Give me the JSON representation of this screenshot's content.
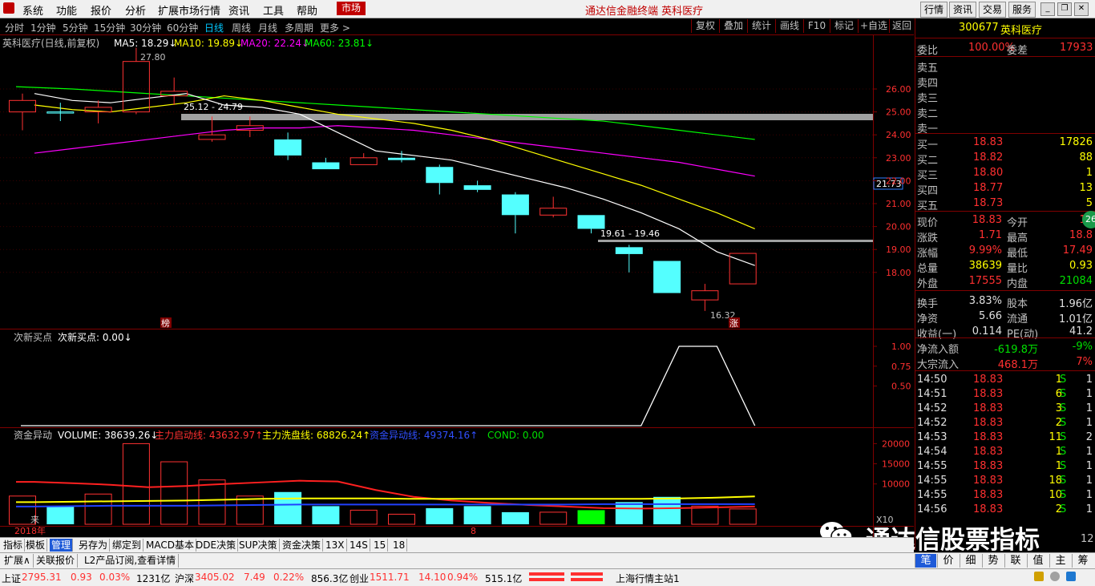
{
  "menu": {
    "items": [
      "系统",
      "功能",
      "报价",
      "分析",
      "扩展市场行情",
      "资讯",
      "工具",
      "帮助"
    ],
    "market_tag": "市场",
    "window_title": "通达信金融终端  英科医疗",
    "right_buttons": [
      "行情",
      "资讯",
      "交易",
      "服务"
    ]
  },
  "periods": {
    "items": [
      "分时",
      "1分钟",
      "5分钟",
      "15分钟",
      "30分钟",
      "60分钟",
      "日线",
      "周线",
      "月线",
      "多周期",
      "更多 >"
    ],
    "active": "日线",
    "right_tools": [
      "复权",
      "叠加",
      "统计",
      "画线",
      "F10",
      "标记",
      "+自选",
      "返回"
    ]
  },
  "main_chart": {
    "stock_label": "英科医疗(日线,前复权)",
    "ma5": "MA5: 18.29↓",
    "ma10": "MA10: 19.89↓",
    "ma20": "MA20: 22.24↓",
    "ma60": "MA60: 23.81↓",
    "price_high_label": "27.80",
    "price_low_label": "16.32",
    "zone1_label": "25.12 - 24.79",
    "zone2_label": "19.61 - 19.46",
    "current_price_tag": "21.73",
    "bang_tag": "榜",
    "zhang_tag": "涨",
    "colors": {
      "ma5": "#ffffff",
      "ma10": "#ffff00",
      "ma20": "#ff00ff",
      "ma60": "#00ff00",
      "up": "#ff3232",
      "down": "#54ffff"
    }
  },
  "chart_data": [
    {
      "type": "candlestick",
      "title": "英科医疗(日线,前复权)",
      "ylim": [
        16.0,
        27.5
      ],
      "yticks": [
        "26.00",
        "25.00",
        "24.00",
        "23.00",
        "22.00",
        "21.00",
        "20.00",
        "19.00",
        "18.00"
      ],
      "candles": [
        {
          "o": 25.0,
          "c": 25.5,
          "h": 25.8,
          "l": 24.2,
          "dir": "up"
        },
        {
          "o": 25.0,
          "c": 25.0,
          "h": 25.4,
          "l": 24.6,
          "dir": "flat"
        },
        {
          "o": 25.0,
          "c": 25.2,
          "h": 25.5,
          "l": 24.5,
          "dir": "up"
        },
        {
          "o": 25.0,
          "c": 27.2,
          "h": 27.8,
          "l": 24.9,
          "dir": "up"
        },
        {
          "o": 25.7,
          "c": 25.9,
          "h": 26.5,
          "l": 25.3,
          "dir": "up"
        },
        {
          "o": 23.8,
          "c": 24.0,
          "h": 24.8,
          "l": 23.7,
          "dir": "up"
        },
        {
          "o": 24.2,
          "c": 24.4,
          "h": 24.8,
          "l": 23.9,
          "dir": "up"
        },
        {
          "o": 23.8,
          "c": 23.1,
          "h": 24.1,
          "l": 22.9,
          "dir": "down"
        },
        {
          "o": 22.8,
          "c": 22.5,
          "h": 23.0,
          "l": 22.5,
          "dir": "down"
        },
        {
          "o": 22.7,
          "c": 23.0,
          "h": 23.2,
          "l": 22.7,
          "dir": "up"
        },
        {
          "o": 23.0,
          "c": 22.9,
          "h": 23.3,
          "l": 22.8,
          "dir": "down"
        },
        {
          "o": 22.6,
          "c": 21.9,
          "h": 22.7,
          "l": 21.4,
          "dir": "down"
        },
        {
          "o": 21.8,
          "c": 21.6,
          "h": 22.0,
          "l": 21.5,
          "dir": "down"
        },
        {
          "o": 21.4,
          "c": 20.5,
          "h": 21.5,
          "l": 19.7,
          "dir": "down"
        },
        {
          "o": 20.5,
          "c": 20.8,
          "h": 21.3,
          "l": 20.4,
          "dir": "up"
        },
        {
          "o": 20.5,
          "c": 19.9,
          "h": 20.5,
          "l": 19.7,
          "dir": "down"
        },
        {
          "o": 19.1,
          "c": 18.8,
          "h": 19.2,
          "l": 18.0,
          "dir": "down"
        },
        {
          "o": 18.5,
          "c": 17.1,
          "h": 18.5,
          "l": 17.1,
          "dir": "down"
        },
        {
          "o": 16.8,
          "c": 17.2,
          "h": 17.5,
          "l": 16.32,
          "dir": "up"
        },
        {
          "o": 17.5,
          "c": 18.83,
          "h": 18.83,
          "l": 17.5,
          "dir": "up"
        }
      ],
      "series": [
        {
          "name": "MA5",
          "values": [
            25.8,
            25.5,
            25.4,
            25.6,
            25.8,
            25.3,
            25.2,
            24.9,
            24.1,
            23.3,
            23.1,
            22.9,
            22.5,
            22.1,
            21.7,
            21.2,
            20.6,
            19.9,
            18.9,
            18.3
          ]
        },
        {
          "name": "MA10",
          "values": [
            25.3,
            25.1,
            25.0,
            25.2,
            25.4,
            25.7,
            25.5,
            25.2,
            24.9,
            24.7,
            24.5,
            24.2,
            23.8,
            23.3,
            22.8,
            22.3,
            21.8,
            21.2,
            20.6,
            19.9
          ]
        },
        {
          "name": "MA20",
          "values": [
            23.2,
            23.4,
            23.6,
            23.8,
            24.0,
            24.2,
            24.3,
            24.3,
            24.4,
            24.3,
            24.2,
            24.0,
            23.8,
            23.6,
            23.4,
            23.2,
            23.0,
            22.8,
            22.5,
            22.2
          ]
        },
        {
          "name": "MA60",
          "values": [
            26.1,
            26.0,
            25.9,
            25.8,
            25.7,
            25.6,
            25.5,
            25.4,
            25.3,
            25.2,
            25.1,
            25.0,
            24.9,
            24.8,
            24.7,
            24.6,
            24.4,
            24.2,
            24.0,
            23.8
          ]
        }
      ]
    },
    {
      "type": "line",
      "title": "次新买点",
      "ylim": [
        0,
        1.0
      ],
      "yticks": [
        "1.00",
        "0.75",
        "0.50"
      ],
      "series": [
        {
          "name": "次新买点",
          "values": [
            0,
            0,
            0,
            0,
            0,
            0,
            0,
            0,
            0,
            0,
            0,
            0,
            0,
            0,
            0,
            0,
            0,
            1,
            1,
            0
          ]
        }
      ]
    },
    {
      "type": "bar",
      "title": "资金异动",
      "ylim": [
        0,
        23000
      ],
      "yticks": [
        "20000",
        "15000",
        "10000"
      ],
      "values": [
        7000,
        4500,
        7500,
        20000,
        15500,
        11000,
        7000,
        8000,
        4500,
        3500,
        2500,
        4000,
        4500,
        3000,
        3000,
        3500,
        5500,
        6800,
        4500,
        3800
      ],
      "bar_dirs": [
        "up",
        "down",
        "up",
        "up",
        "up",
        "up",
        "up",
        "down",
        "down",
        "up",
        "up",
        "down",
        "down",
        "down",
        "up",
        "down",
        "down",
        "down",
        "up",
        "up"
      ],
      "highlight_index": 15,
      "series": [
        {
          "name": "主力启动线",
          "values": [
            10500,
            10200,
            9800,
            9200,
            9500,
            10000,
            10400,
            10800,
            10600,
            8500,
            6800,
            5900,
            5300,
            4800,
            4400,
            4000,
            3900,
            4000,
            4200,
            4400
          ]
        },
        {
          "name": "主力洗盘线",
          "values": [
            5500,
            5600,
            5700,
            5800,
            5900,
            6100,
            6300,
            6400,
            6400,
            6400,
            6300,
            6300,
            6300,
            6300,
            6300,
            6300,
            6300,
            6400,
            6600,
            6900
          ]
        },
        {
          "name": "资金异动线",
          "values": [
            4400,
            4500,
            4600,
            4600,
            4600,
            4700,
            4800,
            4900,
            4900,
            4900,
            4900,
            4900,
            4900,
            4900,
            4900,
            5000,
            5000,
            5000,
            5000,
            5000
          ]
        }
      ]
    }
  ],
  "sub1": {
    "label": "次新买点",
    "value": "次新买点: 0.00↓"
  },
  "sub2": {
    "label": "资金异动",
    "volume": "VOLUME: 38639.26↓",
    "l1": "主力启动线: 43632.97↑",
    "l2": "主力洗盘线: 68826.24↑",
    "l3": "资金异动线: 49374.16↑",
    "cond": "COND: 0.00",
    "x10": "X10",
    "lai": "来"
  },
  "xaxis": {
    "year": "2018年",
    "marker": "8"
  },
  "panel": {
    "code": "300677",
    "name": "英科医疗",
    "weibi_label": "委比",
    "weibi": "100.00%",
    "weicha_label": "委差",
    "weicha": "17933",
    "sell": [
      {
        "label": "卖五"
      },
      {
        "label": "卖四"
      },
      {
        "label": "卖三"
      },
      {
        "label": "卖二"
      },
      {
        "label": "卖一"
      }
    ],
    "buy": [
      {
        "label": "买一",
        "price": "18.83",
        "vol": "17826"
      },
      {
        "label": "买二",
        "price": "18.82",
        "vol": "88"
      },
      {
        "label": "买三",
        "price": "18.80",
        "vol": "1"
      },
      {
        "label": "买四",
        "price": "18.77",
        "vol": "13"
      },
      {
        "label": "买五",
        "price": "18.73",
        "vol": "5"
      }
    ],
    "stats": [
      {
        "l1": "现价",
        "v1": "18.83",
        "l2": "今开",
        "v2": "17"
      },
      {
        "l1": "涨跌",
        "v1": "1.71",
        "l2": "最高",
        "v2": "18.8"
      },
      {
        "l1": "涨幅",
        "v1": "9.99%",
        "l2": "最低",
        "v2": "17.49"
      },
      {
        "l1": "总量",
        "v1": "38639",
        "l2": "量比",
        "v2": "0.93"
      },
      {
        "l1": "外盘",
        "v1": "17555",
        "l2": "内盘",
        "v2": "21084"
      },
      {
        "l1": "换手",
        "v1": "3.83%",
        "l2": "股本",
        "v2": "1.96亿"
      },
      {
        "l1": "净资",
        "v1": "5.66",
        "l2": "流通",
        "v2": "1.01亿"
      },
      {
        "l1": "收益(一)",
        "v1": "0.114",
        "l2": "PE(动)",
        "v2": "41.2"
      }
    ],
    "flow": [
      {
        "label": "净流入额",
        "value": "-619.8万",
        "pct": "-9%"
      },
      {
        "label": "大宗流入",
        "value": "468.1万",
        "pct": "7%"
      }
    ],
    "ticks": [
      {
        "t": "14:50",
        "p": "18.83",
        "v": "1",
        "s": "S",
        "n": "1"
      },
      {
        "t": "14:51",
        "p": "18.83",
        "v": "6",
        "s": "S",
        "n": "1"
      },
      {
        "t": "14:52",
        "p": "18.83",
        "v": "3",
        "s": "S",
        "n": "1"
      },
      {
        "t": "14:52",
        "p": "18.83",
        "v": "2",
        "s": "S",
        "n": "1"
      },
      {
        "t": "14:53",
        "p": "18.83",
        "v": "11",
        "s": "S",
        "n": "2"
      },
      {
        "t": "14:54",
        "p": "18.83",
        "v": "1",
        "s": "S",
        "n": "1"
      },
      {
        "t": "14:55",
        "p": "18.83",
        "v": "1",
        "s": "S",
        "n": "1"
      },
      {
        "t": "14:55",
        "p": "18.83",
        "v": "18",
        "s": "S",
        "n": "1"
      },
      {
        "t": "14:55",
        "p": "18.83",
        "v": "10",
        "s": "S",
        "n": "1"
      },
      {
        "t": "14:56",
        "p": "18.83",
        "v": "2",
        "s": "S",
        "n": "1"
      }
    ],
    "badge": "26",
    "last_num": "12"
  },
  "toolbar1": [
    "指标",
    "模板",
    "管理",
    "另存为",
    "绑定到",
    "MACD基本",
    "DDE决策",
    "SUP决策",
    "资金决策",
    "13X",
    "14S",
    "15",
    "18"
  ],
  "toolbar1_active": "管理",
  "toolbar2": [
    "扩展∧",
    "关联报价",
    "L2产品订阅,查看详情"
  ],
  "toolbar2_right": [
    "笔",
    "价",
    "细",
    "势",
    "联",
    "值",
    "主",
    "筹"
  ],
  "watermark": "通达信股票指标",
  "status": {
    "sh_label": "上证",
    "sh_val": "2795.31",
    "sh_chg": "0.93",
    "sh_pct": "0.03%",
    "sh_amt": "1231亿",
    "sz_label": "沪深",
    "sz_val": "3405.02",
    "sz_chg": "7.49",
    "sz_pct": "0.22%",
    "sz_amt": "856.3亿",
    "cy_label": "创业",
    "cy_val": "1511.71",
    "cy_chg": "14.10",
    "cy_pct": "0.94%",
    "cy_amt": "515.1亿",
    "server": "上海行情主站1"
  }
}
